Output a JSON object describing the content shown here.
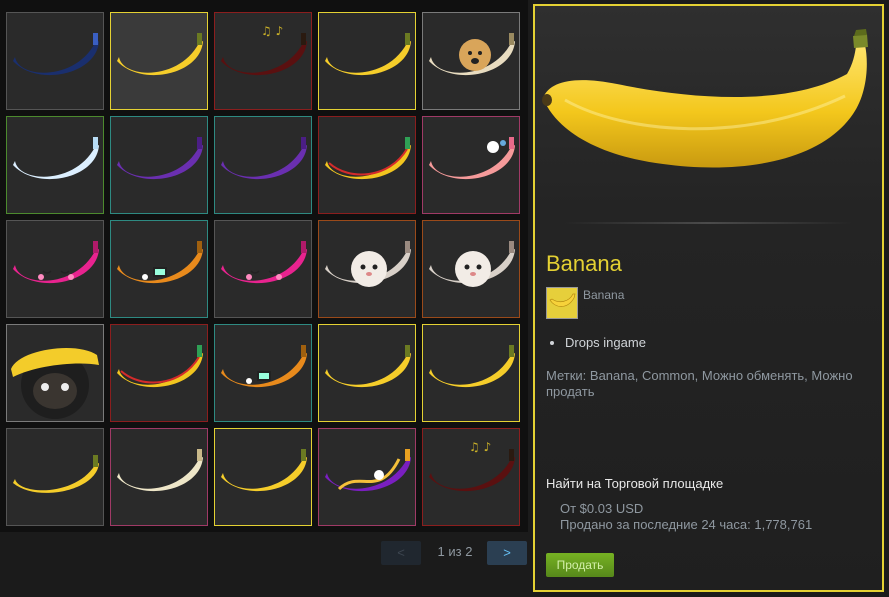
{
  "inventory": {
    "items": [
      {
        "icon": "galaxy-banana-icon",
        "border": "#555555",
        "selected": false
      },
      {
        "icon": "banana-icon",
        "border": "#e4d133",
        "selected": true
      },
      {
        "icon": "music-dark-banana-icon",
        "border": "#8b1e1e",
        "selected": false
      },
      {
        "icon": "banana-icon",
        "border": "#e4d133",
        "selected": false
      },
      {
        "icon": "doge-banana-icon",
        "border": "#7a7a7a",
        "selected": false
      },
      {
        "icon": "ice-banana-icon",
        "border": "#4c8a2e",
        "selected": false
      },
      {
        "icon": "crystal-banana-icon",
        "border": "#2e8a82",
        "selected": false
      },
      {
        "icon": "crystal-banana-icon",
        "border": "#2e8a82",
        "selected": false
      },
      {
        "icon": "glitch-banana-icon",
        "border": "#8b1e1e",
        "selected": false
      },
      {
        "icon": "unicorn-pink-banana-icon",
        "border": "#a03a66",
        "selected": false
      },
      {
        "icon": "kawaii-pink-banana-icon",
        "border": "#555555",
        "selected": false
      },
      {
        "icon": "tamagotchi-banana-icon",
        "border": "#2e8a82",
        "selected": false
      },
      {
        "icon": "kawaii-pink-banana-icon",
        "border": "#555555",
        "selected": false
      },
      {
        "icon": "cat-banana-icon",
        "border": "#9a4a1a",
        "selected": false
      },
      {
        "icon": "cat-banana-icon",
        "border": "#9a4a1a",
        "selected": false
      },
      {
        "icon": "raccoon-banana-icon",
        "border": "#7a7a7a",
        "selected": false
      },
      {
        "icon": "glitch-banana-icon",
        "border": "#8b1e1e",
        "selected": false
      },
      {
        "icon": "tamagotchi-banana-icon",
        "border": "#2e8a82",
        "selected": false
      },
      {
        "icon": "banana-icon",
        "border": "#e4d133",
        "selected": false
      },
      {
        "icon": "banana-icon",
        "border": "#e4d133",
        "selected": false
      },
      {
        "icon": "small-banana-icon",
        "border": "#555555",
        "selected": false
      },
      {
        "icon": "peeled-banana-icon",
        "border": "#a03a66",
        "selected": false
      },
      {
        "icon": "banana-icon",
        "border": "#e4d133",
        "selected": false
      },
      {
        "icon": "cosmic-swirl-banana-icon",
        "border": "#a03a66",
        "selected": false
      },
      {
        "icon": "music-dark-banana-icon",
        "border": "#8b1e1e",
        "selected": false
      }
    ]
  },
  "pagination": {
    "prev_label": "<",
    "next_label": ">",
    "page_info": "1 из 2"
  },
  "detail": {
    "image_icon": "banana-icon",
    "name": "Banana",
    "game_icon": "banana-game-icon",
    "game_name": "Banana",
    "descriptions": [
      "Drops ingame"
    ],
    "tags": "Метки: Banana, Common, Можно обменять, Можно продать",
    "market_title": "Найти на Торговой площадке",
    "price": "От $0.03 USD",
    "sold": "Продано за последние 24 часа: 1,778,761",
    "sell_label": "Продать"
  },
  "colors": {
    "accent": "#e4d133",
    "sell_button": "#75b022",
    "next_button_text": "#67c1f5"
  }
}
